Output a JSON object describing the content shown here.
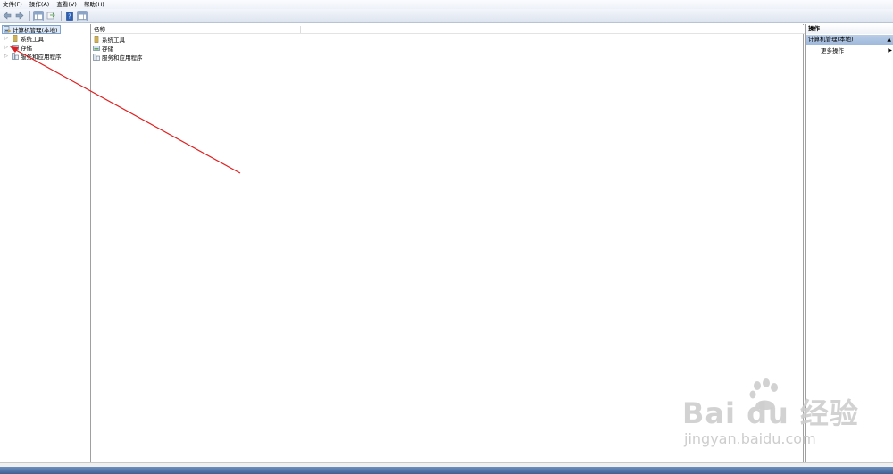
{
  "menubar": {
    "items": [
      "文件(F)",
      "操作(A)",
      "查看(V)",
      "帮助(H)"
    ]
  },
  "toolbar": {
    "buttons": [
      "back-icon",
      "forward-icon",
      "show-hide-tree-icon",
      "export-list-icon",
      "help-icon",
      "show-hide-action-pane-icon"
    ]
  },
  "tree": {
    "root_label": "计算机管理(本地)",
    "nodes": [
      {
        "label": "系统工具",
        "icon": "system-tools-icon"
      },
      {
        "label": "存储",
        "icon": "storage-icon"
      },
      {
        "label": "服务和应用程序",
        "icon": "services-apps-icon"
      }
    ]
  },
  "list": {
    "column_name": "名称",
    "rows": [
      {
        "label": "系统工具",
        "icon": "system-tools-icon"
      },
      {
        "label": "存储",
        "icon": "storage-icon"
      },
      {
        "label": "服务和应用程序",
        "icon": "services-apps-icon"
      }
    ]
  },
  "actions": {
    "title": "操作",
    "section_title": "计算机管理(本地)",
    "more_actions": "更多操作"
  },
  "watermark": {
    "brand": "Bai du 经验",
    "url": "jingyan.baidu.com"
  },
  "colors": {
    "annotation_arrow": "#e02020",
    "selection_bg": "#dfeaf8",
    "section_header": "#a9c2e2"
  }
}
